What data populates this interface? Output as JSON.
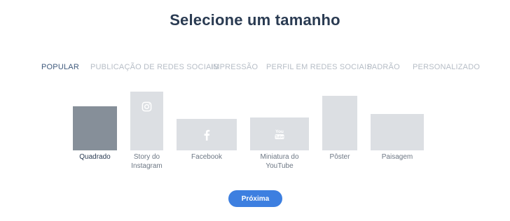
{
  "title": "Selecione um tamanho",
  "tabs": [
    {
      "label": "POPULAR",
      "active": true
    },
    {
      "label": "PUBLICAÇÃO DE REDES SOCIAIS",
      "active": false
    },
    {
      "label": "IMPRESSÃO",
      "active": false
    },
    {
      "label": "PERFIL EM REDES SOCIAIS",
      "active": false
    },
    {
      "label": "PADRÃO",
      "active": false
    },
    {
      "label": "PERSONALIZADO",
      "active": false
    }
  ],
  "options": [
    {
      "label": "Quadrado",
      "icon": "none",
      "selected": true
    },
    {
      "label": "Story do Instagram",
      "icon": "instagram-icon",
      "selected": false
    },
    {
      "label": "Facebook",
      "icon": "facebook-icon",
      "selected": false
    },
    {
      "label": "Miniatura do YouTube",
      "icon": "youtube-icon",
      "selected": false
    },
    {
      "label": "Pôster",
      "icon": "none",
      "selected": false
    },
    {
      "label": "Paisagem",
      "icon": "none",
      "selected": false
    }
  ],
  "next_button": "Próxima",
  "colors": {
    "title": "#2a3b52",
    "tab_active": "#3f5a7c",
    "tab_inactive": "#b6bdc6",
    "thumb": "#dcdfe3",
    "thumb_selected": "#868f99",
    "button": "#3d7fe0"
  }
}
